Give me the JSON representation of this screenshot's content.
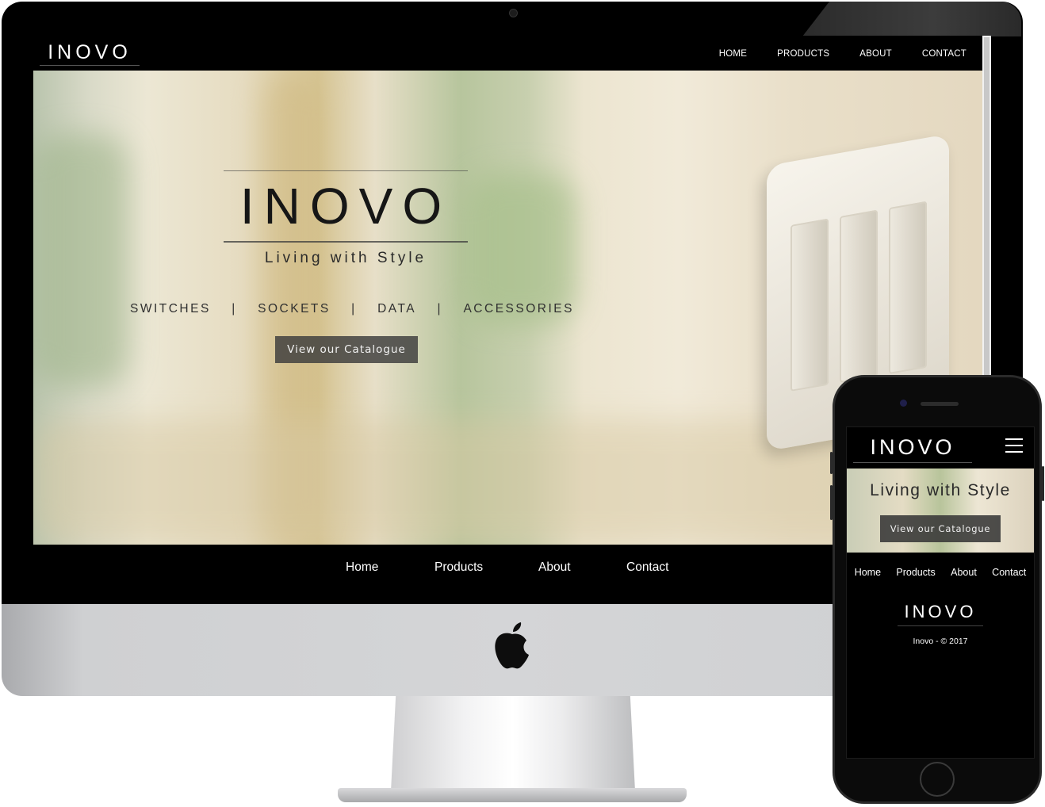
{
  "desktop": {
    "brand": "INOVO",
    "top_nav": [
      "HOME",
      "PRODUCTS",
      "ABOUT",
      "CONTACT"
    ],
    "hero": {
      "logo": "INOVO",
      "tagline": "Living with Style",
      "categories": [
        "SWITCHES",
        "|",
        "SOCKETS",
        "|",
        "DATA",
        "|",
        "ACCESSORIES"
      ],
      "cta": "View our Catalogue"
    },
    "footer_nav": [
      "Home",
      "Products",
      "About",
      "Contact"
    ]
  },
  "mobile": {
    "brand": "INOVO",
    "tagline": "Living with Style",
    "cta": "View our Catalogue",
    "nav": [
      "Home",
      "Products",
      "About",
      "Contact"
    ],
    "footer_logo": "INOVO",
    "copyright": "Inovo - © 2017"
  },
  "icons": {
    "menu": "hamburger-icon",
    "brand_logo": "apple-logo-icon"
  }
}
